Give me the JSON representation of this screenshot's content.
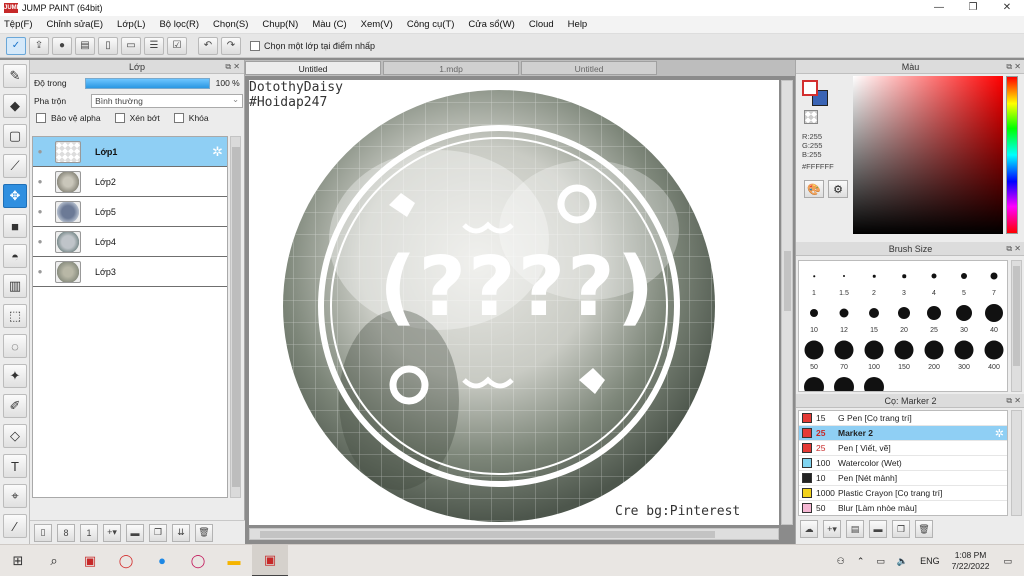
{
  "app": {
    "title": "JUMP PAINT (64bit)",
    "logo_text": "JUMP"
  },
  "menu": [
    "Tệp(F)",
    "Chỉnh sửa(E)",
    "Lớp(L)",
    "Bộ lọc(R)",
    "Chọn(S)",
    "Chụp(N)",
    "Màu (C)",
    "Xem(V)",
    "Công cụ(T)",
    "Cửa sổ(W)",
    "Cloud",
    "Help"
  ],
  "toolbar": {
    "checkbox_label": "Chọn một lớp tại điểm nhấp"
  },
  "layer_panel": {
    "title": "Lớp",
    "opacity_label": "Độ trong",
    "opacity_value": "100 %",
    "opacity_fraction": 1.0,
    "blend_label": "Pha trộn",
    "blend_value": "Bình thường",
    "protect_alpha": "Bảo vệ alpha",
    "clipping": "Xén bớt",
    "lock": "Khóa",
    "layers": [
      {
        "name": "Lớp1",
        "selected": true
      },
      {
        "name": "Lớp2",
        "selected": false
      },
      {
        "name": "Lớp5",
        "selected": false
      },
      {
        "name": "Lớp4",
        "selected": false
      },
      {
        "name": "Lớp3",
        "selected": false
      }
    ]
  },
  "canvas": {
    "tabs": [
      "Untitled",
      "1.mdp",
      "Untitled"
    ],
    "active_tab": 0,
    "watermark_line1": "DotothyDaisy",
    "watermark_line2": "#Hoidap247",
    "credit": "Cre bg:Pinterest",
    "center_text": "(????)"
  },
  "color_panel": {
    "title": "Màu",
    "r": "R:255",
    "g": "G:255",
    "b": "B:255",
    "hex": "#FFFFFF",
    "foreground_color": "#FFFFFF",
    "background_color": "#3A64B5",
    "hue_color": "#FF0000"
  },
  "brush_size_panel": {
    "title": "Brush Size",
    "sizes": [
      "1",
      "1.5",
      "2",
      "3",
      "4",
      "5",
      "7",
      "10",
      "12",
      "15",
      "20",
      "25",
      "30",
      "40",
      "50",
      "70",
      "100",
      "150",
      "200",
      "300",
      "400"
    ]
  },
  "sub_tool_panel": {
    "title": "Cọ: Marker 2",
    "items": [
      {
        "size": "15",
        "name": "G Pen [Cọ trang trí]",
        "color": "#E53935",
        "selected": false,
        "red": false
      },
      {
        "size": "25",
        "name": "Marker 2",
        "color": "#E53935",
        "selected": true,
        "red": true
      },
      {
        "size": "25",
        "name": "Pen [ Viết, vẽ]",
        "color": "#E53935",
        "selected": false,
        "red": true
      },
      {
        "size": "100",
        "name": "Watercolor (Wet)",
        "color": "#7FD4F0",
        "selected": false,
        "red": false
      },
      {
        "size": "10",
        "name": "Pen [Nét mảnh]",
        "color": "#222222",
        "selected": false,
        "red": false
      },
      {
        "size": "1000",
        "name": "Plastic Crayon [Cọ trang trí]",
        "color": "#F2D21B",
        "selected": false,
        "red": false
      },
      {
        "size": "50",
        "name": "Blur [Làm nhòe màu]",
        "color": "#F4B6D2",
        "selected": false,
        "red": false
      }
    ]
  },
  "taskbar": {
    "language": "ENG",
    "time": "1:08 PM",
    "date": "7/22/2022"
  }
}
